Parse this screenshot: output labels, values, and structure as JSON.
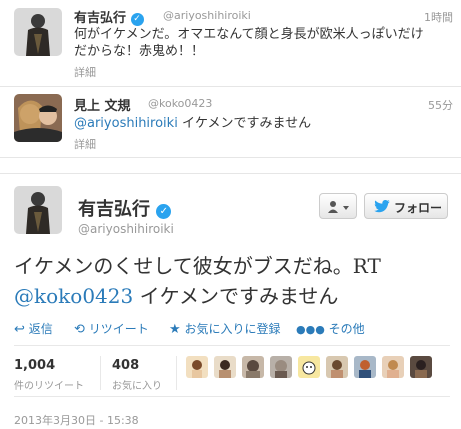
{
  "tweet1": {
    "name": "有吉弘行",
    "handle": "@ariyoshihiroiki",
    "time": "1時間",
    "text_line1": "何がイケメンだ。オマエなんて顔と身長が欧米人っぽいだけ",
    "text_line2": "だからな！赤鬼め！！",
    "details": "詳細"
  },
  "tweet2": {
    "name": "見上 文規",
    "handle": "@koko0423",
    "time": "55分",
    "mention": "@ariyoshihiroiki",
    "text": " イケメンですみません",
    "details": "詳細"
  },
  "main": {
    "name": "有吉弘行",
    "handle": "@ariyoshihiroiki",
    "follow_label": "フォロー",
    "text_line1": "イケメンのくせして彼女がブスだね。RT",
    "mention": "@koko0423",
    "text_line2": " イケメンですみません",
    "actions": {
      "reply": "返信",
      "retweet": "リツイート",
      "favorite": "お気に入りに登録",
      "more": "その他"
    },
    "stats": {
      "retweets_count": "1,004",
      "retweets_label": "件のリツイート",
      "favorites_count": "408",
      "favorites_label": "お気に入り"
    },
    "date": "2013年3月30日 - 15:38"
  }
}
